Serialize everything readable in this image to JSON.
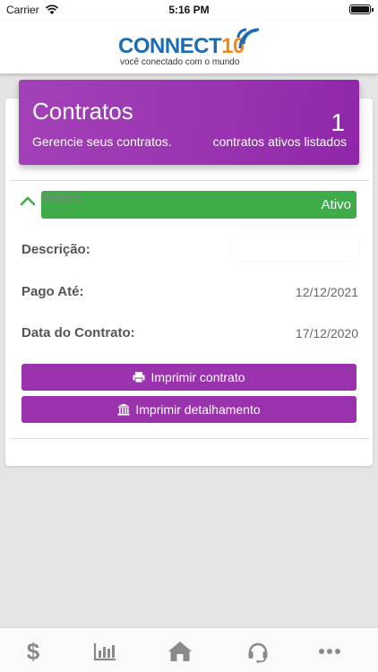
{
  "status_bar": {
    "carrier": "Carrier",
    "time": "5:16 PM"
  },
  "header": {
    "logo_text_a": "CO",
    "logo_text_b": "NNECT",
    "logo_text_c": "10",
    "logo_tagline": "você conectado com o mundo"
  },
  "contracts_panel": {
    "title": "Contratos",
    "subtitle": "Gerencie seus contratos.",
    "count": "1",
    "count_label": "contratos ativos listados"
  },
  "contract": {
    "status_label": "Status:",
    "status_value": "Ativo",
    "description_label": "Descrição:",
    "description_value": "",
    "paid_until_label": "Pago Até:",
    "paid_until_value": "12/12/2021",
    "contract_date_label": "Data do Contrato:",
    "contract_date_value": "17/12/2020",
    "print_contract_label": "Imprimir contrato",
    "print_details_label": "Imprimir detalhamento"
  },
  "tab_bar": {
    "items": [
      {
        "icon": "dollar-icon",
        "label": "$"
      },
      {
        "icon": "bar-chart-icon"
      },
      {
        "icon": "home-icon"
      },
      {
        "icon": "headset-icon"
      },
      {
        "icon": "more-icon"
      }
    ]
  },
  "colors": {
    "purple": "#9a32ad",
    "green": "#3fac4a",
    "logo_blue": "#1b6cb5",
    "logo_orange": "#f08a1d"
  }
}
